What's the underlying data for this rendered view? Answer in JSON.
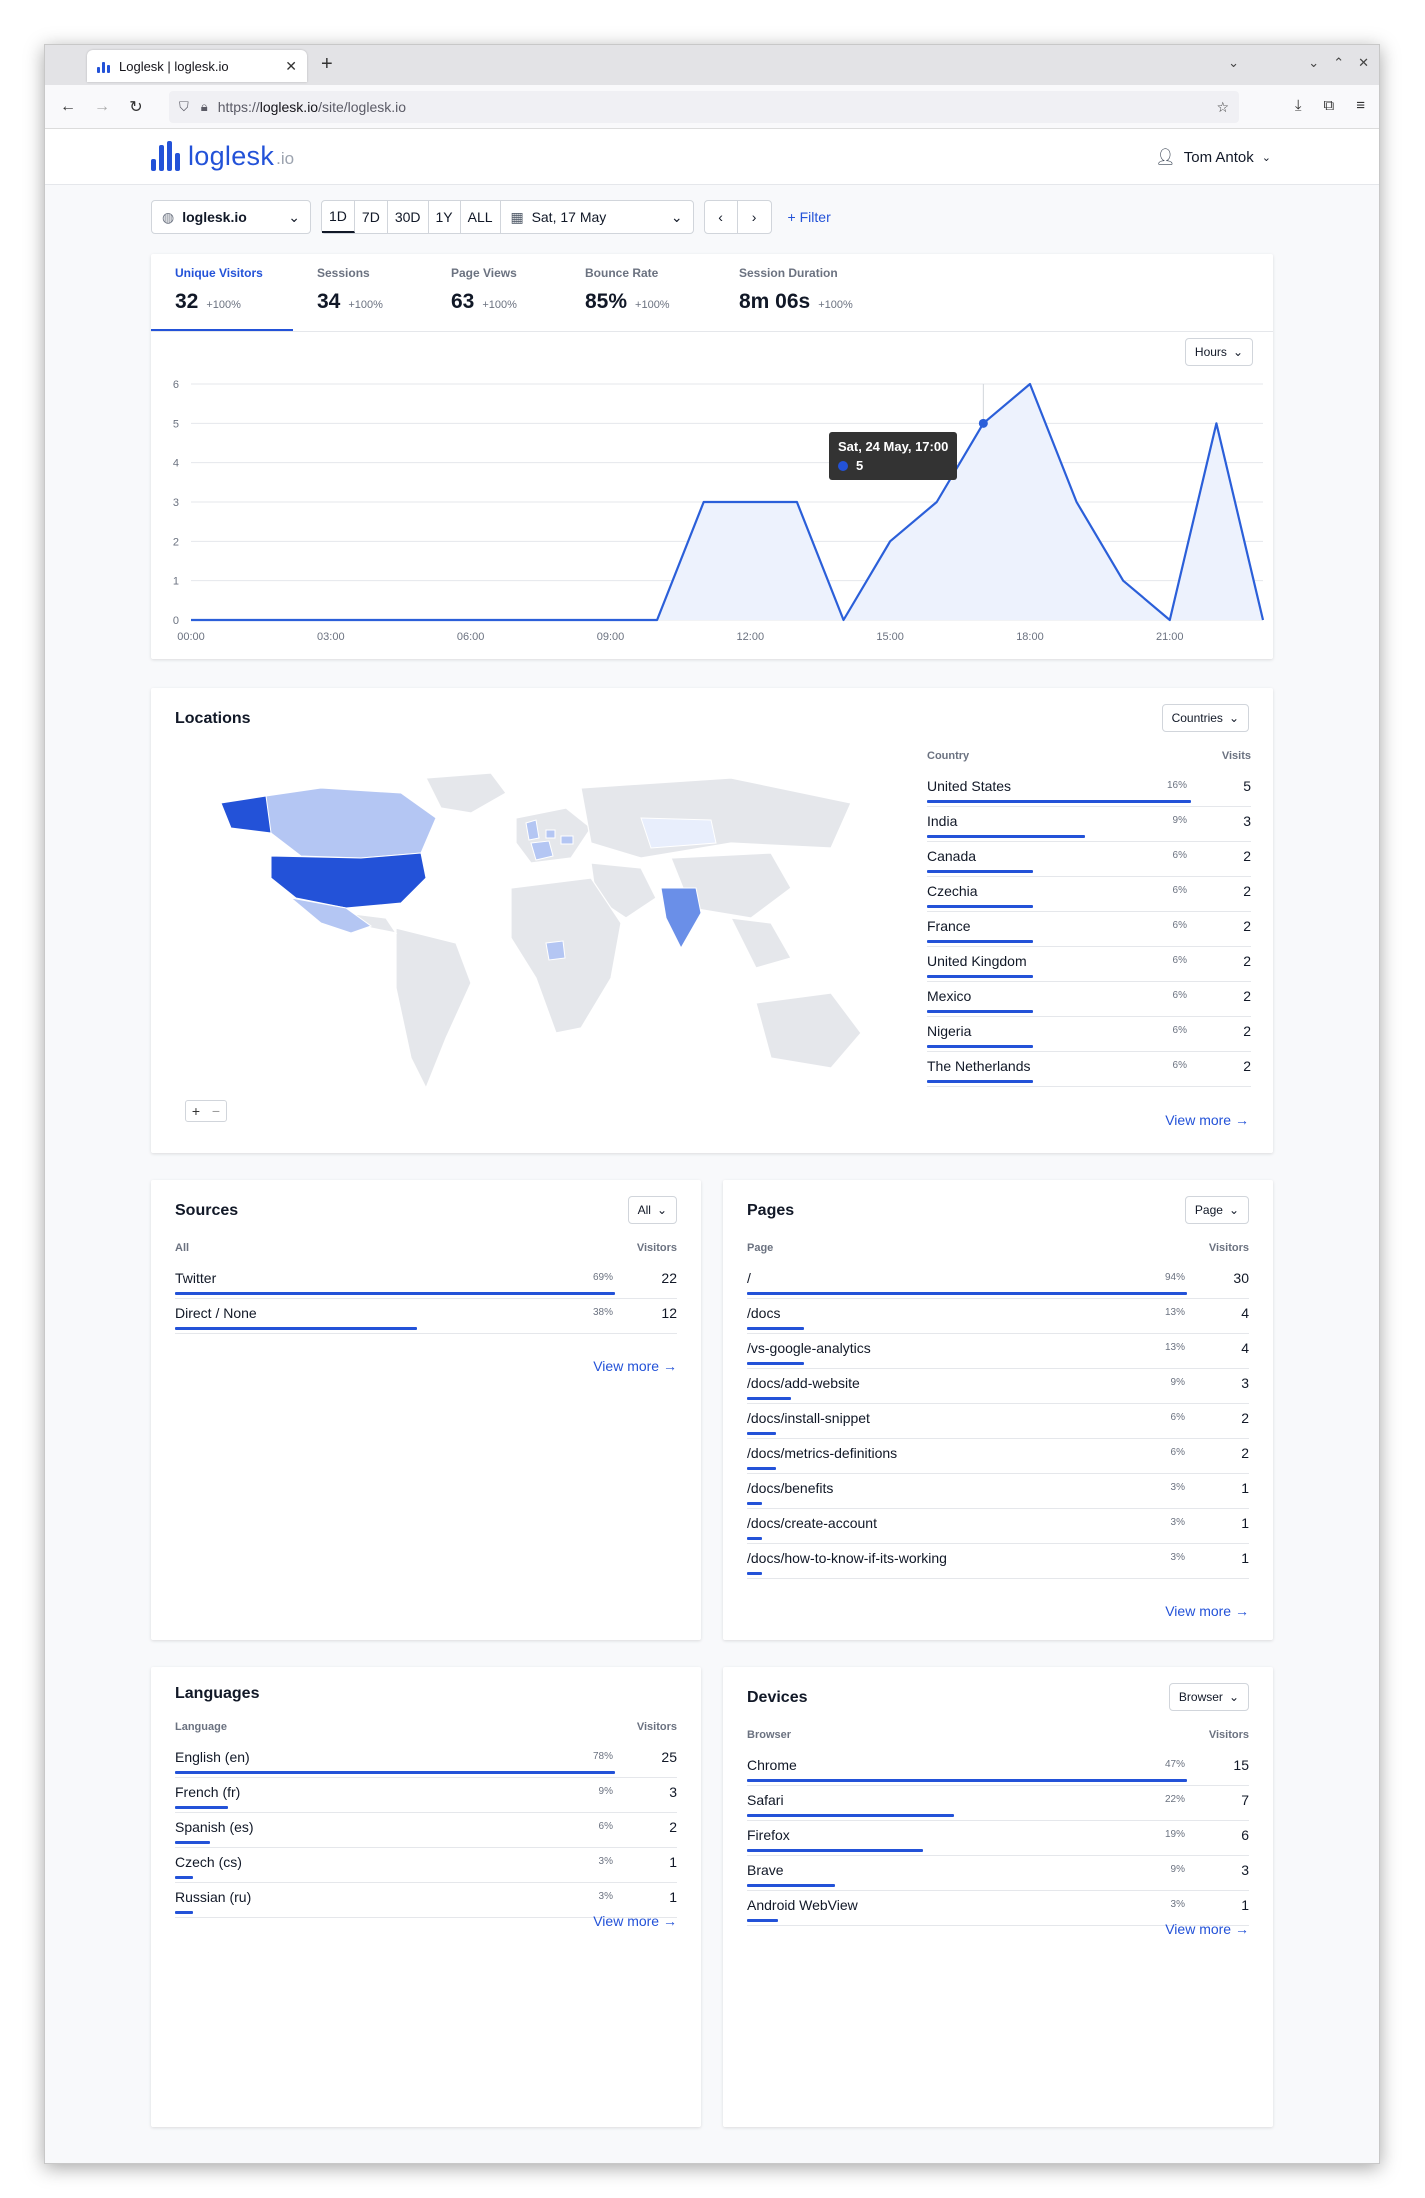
{
  "browser": {
    "tab_title": "Loglesk | loglesk.io",
    "url_prefix": "https://",
    "url_host": "loglesk.io",
    "url_path": "/site/loglesk.io"
  },
  "app": {
    "logo_name": "loglesk",
    "logo_tld": ".io",
    "user_name": "Tom Antok"
  },
  "toolbar": {
    "site": "loglesk.io",
    "ranges": [
      "1D",
      "7D",
      "30D",
      "1Y",
      "ALL"
    ],
    "active_range": "1D",
    "date": "Sat, 17 May",
    "filter_label": "Filter"
  },
  "metrics": [
    {
      "label": "Unique Visitors",
      "value": "32",
      "change": "+100%"
    },
    {
      "label": "Sessions",
      "value": "34",
      "change": "+100%"
    },
    {
      "label": "Page Views",
      "value": "63",
      "change": "+100%"
    },
    {
      "label": "Bounce Rate",
      "value": "85%",
      "change": "+100%"
    },
    {
      "label": "Session Duration",
      "value": "8m 06s",
      "change": "+100%"
    }
  ],
  "chart_data": {
    "type": "area",
    "x": [
      "00:00",
      "01:00",
      "02:00",
      "03:00",
      "04:00",
      "05:00",
      "06:00",
      "07:00",
      "08:00",
      "09:00",
      "10:00",
      "11:00",
      "12:00",
      "13:00",
      "14:00",
      "15:00",
      "16:00",
      "17:00",
      "18:00",
      "19:00",
      "20:00",
      "21:00",
      "22:00",
      "23:00"
    ],
    "values": [
      0,
      0,
      0,
      0,
      0,
      0,
      0,
      0,
      0,
      0,
      0,
      3,
      3,
      3,
      0,
      2,
      3,
      5,
      6,
      3,
      1,
      0,
      5,
      0
    ],
    "xticks": [
      "00:00",
      "03:00",
      "06:00",
      "09:00",
      "12:00",
      "15:00",
      "18:00",
      "21:00"
    ],
    "yticks": [
      "0",
      "1",
      "2",
      "3",
      "4",
      "5",
      "6"
    ],
    "ylim": [
      0,
      6
    ],
    "grid": true,
    "color": "#2b5fd9",
    "granularity_button": "Hours",
    "tooltip": {
      "title": "Sat, 24 May, 17:00",
      "value": "5"
    }
  },
  "locations": {
    "title": "Locations",
    "button": "Countries",
    "col_label": "Country",
    "col_value": "Visits",
    "rows": [
      {
        "label": "United States",
        "pct": "16%",
        "value": "5",
        "frac": 1.0
      },
      {
        "label": "India",
        "pct": "9%",
        "value": "3",
        "frac": 0.6
      },
      {
        "label": "Canada",
        "pct": "6%",
        "value": "2",
        "frac": 0.4
      },
      {
        "label": "Czechia",
        "pct": "6%",
        "value": "2",
        "frac": 0.4
      },
      {
        "label": "France",
        "pct": "6%",
        "value": "2",
        "frac": 0.4
      },
      {
        "label": "United Kingdom",
        "pct": "6%",
        "value": "2",
        "frac": 0.4
      },
      {
        "label": "Mexico",
        "pct": "6%",
        "value": "2",
        "frac": 0.4
      },
      {
        "label": "Nigeria",
        "pct": "6%",
        "value": "2",
        "frac": 0.4
      },
      {
        "label": "The Netherlands",
        "pct": "6%",
        "value": "2",
        "frac": 0.4
      }
    ],
    "view_more": "View more"
  },
  "sources": {
    "title": "Sources",
    "button": "All",
    "col_label": "All",
    "col_value": "Visitors",
    "rows": [
      {
        "label": "Twitter",
        "pct": "69%",
        "value": "22",
        "frac": 1.0
      },
      {
        "label": "Direct / None",
        "pct": "38%",
        "value": "12",
        "frac": 0.55
      }
    ],
    "view_more": "View more"
  },
  "pages": {
    "title": "Pages",
    "button": "Page",
    "col_label": "Page",
    "col_value": "Visitors",
    "rows": [
      {
        "label": "/",
        "pct": "94%",
        "value": "30",
        "frac": 1.0
      },
      {
        "label": "/docs",
        "pct": "13%",
        "value": "4",
        "frac": 0.13
      },
      {
        "label": "/vs-google-analytics",
        "pct": "13%",
        "value": "4",
        "frac": 0.13
      },
      {
        "label": "/docs/add-website",
        "pct": "9%",
        "value": "3",
        "frac": 0.1
      },
      {
        "label": "/docs/install-snippet",
        "pct": "6%",
        "value": "2",
        "frac": 0.067
      },
      {
        "label": "/docs/metrics-definitions",
        "pct": "6%",
        "value": "2",
        "frac": 0.067
      },
      {
        "label": "/docs/benefits",
        "pct": "3%",
        "value": "1",
        "frac": 0.033
      },
      {
        "label": "/docs/create-account",
        "pct": "3%",
        "value": "1",
        "frac": 0.033
      },
      {
        "label": "/docs/how-to-know-if-its-working",
        "pct": "3%",
        "value": "1",
        "frac": 0.033
      }
    ],
    "view_more": "View more"
  },
  "languages": {
    "title": "Languages",
    "col_label": "Language",
    "col_value": "Visitors",
    "rows": [
      {
        "label": "English (en)",
        "pct": "78%",
        "value": "25",
        "frac": 1.0
      },
      {
        "label": "French (fr)",
        "pct": "9%",
        "value": "3",
        "frac": 0.12
      },
      {
        "label": "Spanish (es)",
        "pct": "6%",
        "value": "2",
        "frac": 0.08
      },
      {
        "label": "Czech (cs)",
        "pct": "3%",
        "value": "1",
        "frac": 0.04
      },
      {
        "label": "Russian (ru)",
        "pct": "3%",
        "value": "1",
        "frac": 0.04
      }
    ],
    "view_more": "View more"
  },
  "devices": {
    "title": "Devices",
    "button": "Browser",
    "col_label": "Browser",
    "col_value": "Visitors",
    "rows": [
      {
        "label": "Chrome",
        "pct": "47%",
        "value": "15",
        "frac": 1.0
      },
      {
        "label": "Safari",
        "pct": "22%",
        "value": "7",
        "frac": 0.47
      },
      {
        "label": "Firefox",
        "pct": "19%",
        "value": "6",
        "frac": 0.4
      },
      {
        "label": "Brave",
        "pct": "9%",
        "value": "3",
        "frac": 0.2
      },
      {
        "label": "Android WebView",
        "pct": "3%",
        "value": "1",
        "frac": 0.07
      }
    ],
    "view_more": "View more"
  }
}
